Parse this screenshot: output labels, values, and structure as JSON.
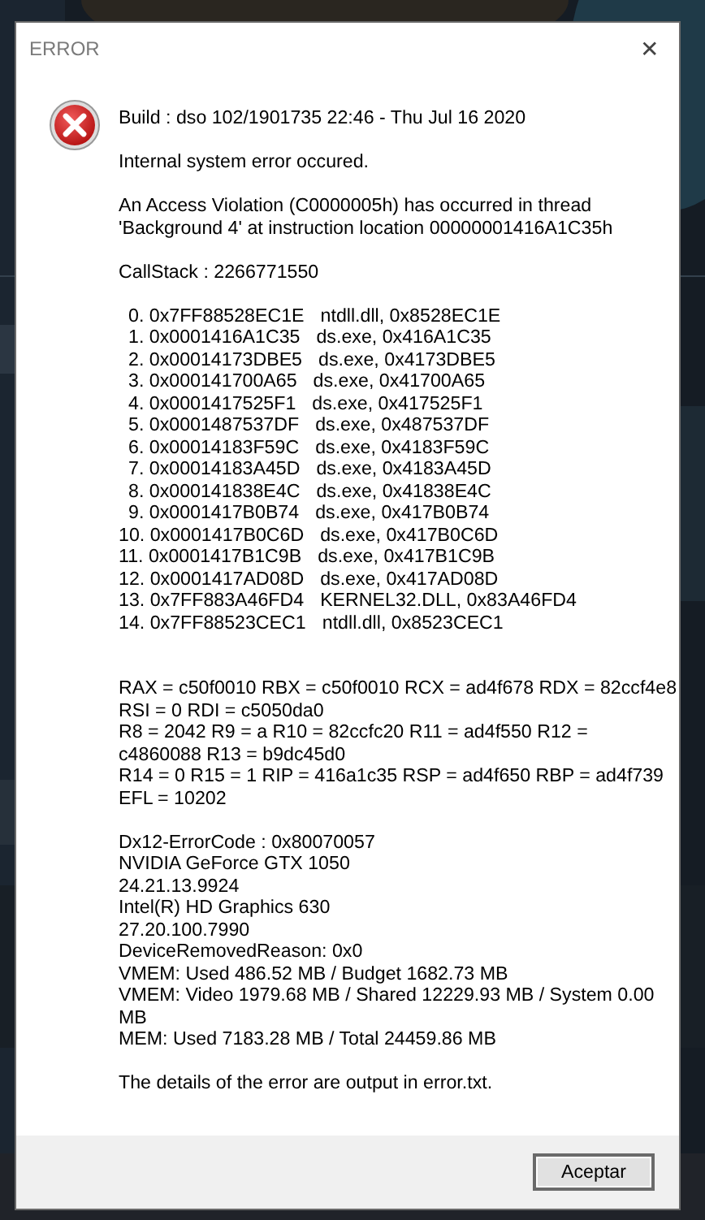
{
  "dialog": {
    "title": "ERROR",
    "close": "✕",
    "blocks": [
      {
        "kind": "lines",
        "lines": [
          "Build : dso 102/1901735 22:46 - Thu Jul 16 2020"
        ]
      },
      {
        "kind": "lines",
        "lines": [
          "Internal system error occured."
        ]
      },
      {
        "kind": "lines",
        "lines": [
          "An Access Violation (C0000005h) has occurred in thread",
          "'Background 4' at instruction location 00000001416A1C35h"
        ]
      },
      {
        "kind": "lines",
        "lines": [
          "CallStack : 2266771550"
        ]
      },
      {
        "kind": "stack",
        "frames": [
          {
            "entry": "0. 0x7FF88528EC1E",
            "module": "ntdll.dll, 0x8528EC1E"
          },
          {
            "entry": "1. 0x0001416A1C35",
            "module": "ds.exe, 0x416A1C35"
          },
          {
            "entry": "2. 0x00014173DBE5",
            "module": "ds.exe, 0x4173DBE5"
          },
          {
            "entry": "3. 0x000141700A65",
            "module": "ds.exe, 0x41700A65"
          },
          {
            "entry": "4. 0x0001417525F1",
            "module": "ds.exe, 0x417525F1"
          },
          {
            "entry": "5. 0x0001487537DF",
            "module": "ds.exe, 0x487537DF"
          },
          {
            "entry": "6. 0x00014183F59C",
            "module": "ds.exe, 0x4183F59C"
          },
          {
            "entry": "7. 0x00014183A45D",
            "module": "ds.exe, 0x4183A45D"
          },
          {
            "entry": "8. 0x000141838E4C",
            "module": "ds.exe, 0x41838E4C"
          },
          {
            "entry": "9. 0x0001417B0B74",
            "module": "ds.exe, 0x417B0B74"
          },
          {
            "entry": "10. 0x0001417B0C6D",
            "module": "ds.exe, 0x417B0C6D"
          },
          {
            "entry": "11. 0x0001417B1C9B",
            "module": "ds.exe, 0x417B1C9B"
          },
          {
            "entry": "12. 0x0001417AD08D",
            "module": "ds.exe, 0x417AD08D"
          },
          {
            "entry": "13. 0x7FF883A46FD4",
            "module": "KERNEL32.DLL, 0x83A46FD4"
          },
          {
            "entry": "14. 0x7FF88523CEC1",
            "module": "ntdll.dll, 0x8523CEC1"
          }
        ]
      },
      {
        "kind": "lines",
        "lines": [
          "RAX = c50f0010 RBX = c50f0010 RCX = ad4f678 RDX = 82ccf4e8",
          "RSI = 0 RDI = c5050da0",
          "R8 = 2042 R9 = a R10 = 82ccfc20 R11 = ad4f550 R12 =",
          "c4860088 R13 = b9dc45d0",
          "R14 = 0 R15 = 1 RIP = 416a1c35 RSP = ad4f650 RBP = ad4f739",
          "EFL = 10202"
        ]
      },
      {
        "kind": "lines",
        "lines": [
          "Dx12-ErrorCode : 0x80070057",
          "NVIDIA GeForce GTX 1050",
          "24.21.13.9924",
          "Intel(R) HD Graphics 630",
          "27.20.100.7990",
          "DeviceRemovedReason: 0x0",
          "VMEM: Used 486.52 MB / Budget 1682.73 MB",
          "VMEM: Video 1979.68 MB / Shared 12229.93 MB / System 0.00",
          "MB",
          "MEM: Used 7183.28 MB / Total 24459.86 MB"
        ]
      },
      {
        "kind": "lines",
        "lines": [
          "The details of the error are output in error.txt."
        ]
      }
    ],
    "buttons": [
      "Aceptar"
    ]
  }
}
